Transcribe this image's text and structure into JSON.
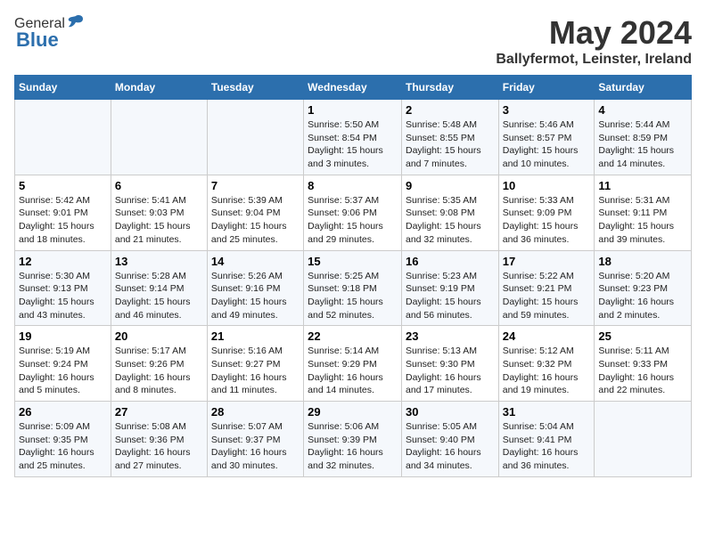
{
  "logo": {
    "general": "General",
    "blue": "Blue"
  },
  "title": "May 2024",
  "location": "Ballyfermot, Leinster, Ireland",
  "days_of_week": [
    "Sunday",
    "Monday",
    "Tuesday",
    "Wednesday",
    "Thursday",
    "Friday",
    "Saturday"
  ],
  "weeks": [
    [
      {
        "day": "",
        "info": ""
      },
      {
        "day": "",
        "info": ""
      },
      {
        "day": "",
        "info": ""
      },
      {
        "day": "1",
        "info": "Sunrise: 5:50 AM\nSunset: 8:54 PM\nDaylight: 15 hours\nand 3 minutes."
      },
      {
        "day": "2",
        "info": "Sunrise: 5:48 AM\nSunset: 8:55 PM\nDaylight: 15 hours\nand 7 minutes."
      },
      {
        "day": "3",
        "info": "Sunrise: 5:46 AM\nSunset: 8:57 PM\nDaylight: 15 hours\nand 10 minutes."
      },
      {
        "day": "4",
        "info": "Sunrise: 5:44 AM\nSunset: 8:59 PM\nDaylight: 15 hours\nand 14 minutes."
      }
    ],
    [
      {
        "day": "5",
        "info": "Sunrise: 5:42 AM\nSunset: 9:01 PM\nDaylight: 15 hours\nand 18 minutes."
      },
      {
        "day": "6",
        "info": "Sunrise: 5:41 AM\nSunset: 9:03 PM\nDaylight: 15 hours\nand 21 minutes."
      },
      {
        "day": "7",
        "info": "Sunrise: 5:39 AM\nSunset: 9:04 PM\nDaylight: 15 hours\nand 25 minutes."
      },
      {
        "day": "8",
        "info": "Sunrise: 5:37 AM\nSunset: 9:06 PM\nDaylight: 15 hours\nand 29 minutes."
      },
      {
        "day": "9",
        "info": "Sunrise: 5:35 AM\nSunset: 9:08 PM\nDaylight: 15 hours\nand 32 minutes."
      },
      {
        "day": "10",
        "info": "Sunrise: 5:33 AM\nSunset: 9:09 PM\nDaylight: 15 hours\nand 36 minutes."
      },
      {
        "day": "11",
        "info": "Sunrise: 5:31 AM\nSunset: 9:11 PM\nDaylight: 15 hours\nand 39 minutes."
      }
    ],
    [
      {
        "day": "12",
        "info": "Sunrise: 5:30 AM\nSunset: 9:13 PM\nDaylight: 15 hours\nand 43 minutes."
      },
      {
        "day": "13",
        "info": "Sunrise: 5:28 AM\nSunset: 9:14 PM\nDaylight: 15 hours\nand 46 minutes."
      },
      {
        "day": "14",
        "info": "Sunrise: 5:26 AM\nSunset: 9:16 PM\nDaylight: 15 hours\nand 49 minutes."
      },
      {
        "day": "15",
        "info": "Sunrise: 5:25 AM\nSunset: 9:18 PM\nDaylight: 15 hours\nand 52 minutes."
      },
      {
        "day": "16",
        "info": "Sunrise: 5:23 AM\nSunset: 9:19 PM\nDaylight: 15 hours\nand 56 minutes."
      },
      {
        "day": "17",
        "info": "Sunrise: 5:22 AM\nSunset: 9:21 PM\nDaylight: 15 hours\nand 59 minutes."
      },
      {
        "day": "18",
        "info": "Sunrise: 5:20 AM\nSunset: 9:23 PM\nDaylight: 16 hours\nand 2 minutes."
      }
    ],
    [
      {
        "day": "19",
        "info": "Sunrise: 5:19 AM\nSunset: 9:24 PM\nDaylight: 16 hours\nand 5 minutes."
      },
      {
        "day": "20",
        "info": "Sunrise: 5:17 AM\nSunset: 9:26 PM\nDaylight: 16 hours\nand 8 minutes."
      },
      {
        "day": "21",
        "info": "Sunrise: 5:16 AM\nSunset: 9:27 PM\nDaylight: 16 hours\nand 11 minutes."
      },
      {
        "day": "22",
        "info": "Sunrise: 5:14 AM\nSunset: 9:29 PM\nDaylight: 16 hours\nand 14 minutes."
      },
      {
        "day": "23",
        "info": "Sunrise: 5:13 AM\nSunset: 9:30 PM\nDaylight: 16 hours\nand 17 minutes."
      },
      {
        "day": "24",
        "info": "Sunrise: 5:12 AM\nSunset: 9:32 PM\nDaylight: 16 hours\nand 19 minutes."
      },
      {
        "day": "25",
        "info": "Sunrise: 5:11 AM\nSunset: 9:33 PM\nDaylight: 16 hours\nand 22 minutes."
      }
    ],
    [
      {
        "day": "26",
        "info": "Sunrise: 5:09 AM\nSunset: 9:35 PM\nDaylight: 16 hours\nand 25 minutes."
      },
      {
        "day": "27",
        "info": "Sunrise: 5:08 AM\nSunset: 9:36 PM\nDaylight: 16 hours\nand 27 minutes."
      },
      {
        "day": "28",
        "info": "Sunrise: 5:07 AM\nSunset: 9:37 PM\nDaylight: 16 hours\nand 30 minutes."
      },
      {
        "day": "29",
        "info": "Sunrise: 5:06 AM\nSunset: 9:39 PM\nDaylight: 16 hours\nand 32 minutes."
      },
      {
        "day": "30",
        "info": "Sunrise: 5:05 AM\nSunset: 9:40 PM\nDaylight: 16 hours\nand 34 minutes."
      },
      {
        "day": "31",
        "info": "Sunrise: 5:04 AM\nSunset: 9:41 PM\nDaylight: 16 hours\nand 36 minutes."
      },
      {
        "day": "",
        "info": ""
      }
    ]
  ]
}
